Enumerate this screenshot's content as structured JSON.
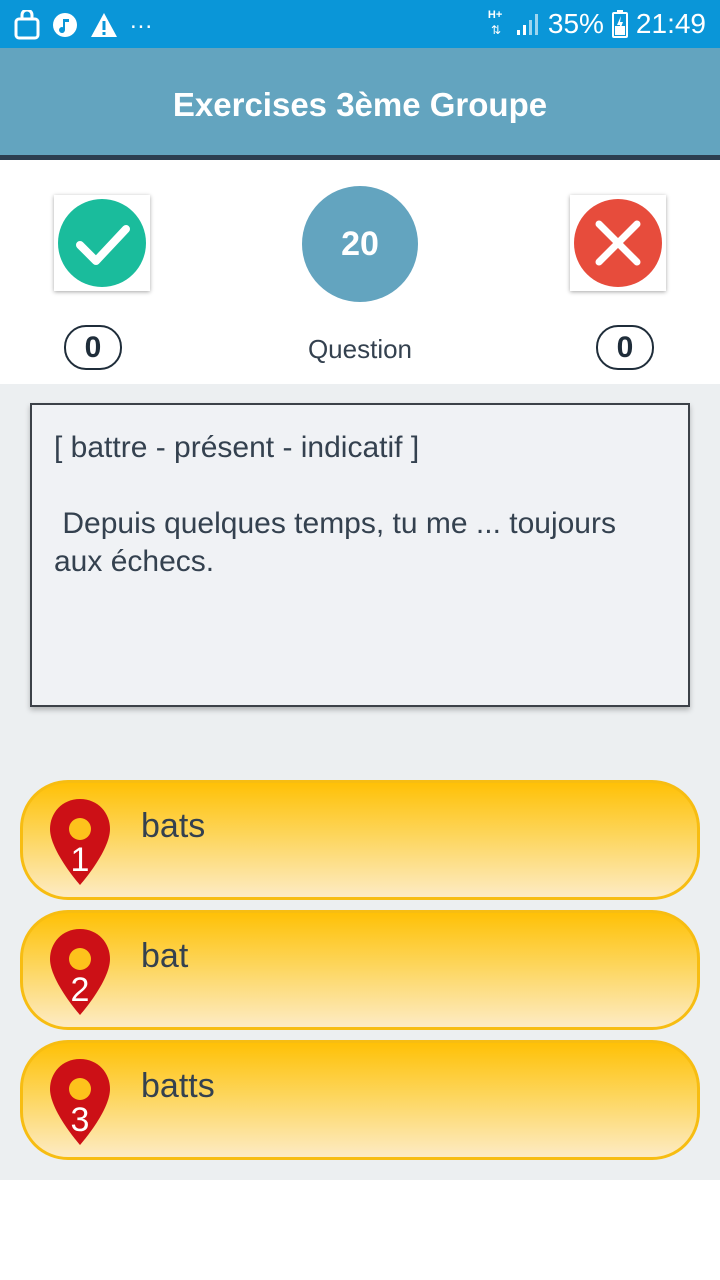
{
  "status_bar": {
    "battery": "35%",
    "time": "21:49",
    "network": "H+",
    "overflow": "...",
    "icons": [
      "bag-icon",
      "music-icon",
      "warning-icon",
      "data-arrows-icon",
      "signal-icon",
      "battery-charging-icon"
    ]
  },
  "app_bar": {
    "title": "Exercises 3ème Groupe"
  },
  "score": {
    "correct_count": "0",
    "wrong_count": "0",
    "question_number": "20",
    "question_label": "Question"
  },
  "question": {
    "prompt": "[ battre - présent - indicatif ]",
    "sentence": "Depuis quelques temps, tu me ... toujours aux échecs."
  },
  "answers": [
    {
      "number": "1",
      "label": "bats"
    },
    {
      "number": "2",
      "label": "bat"
    },
    {
      "number": "3",
      "label": "batts"
    }
  ],
  "colors": {
    "status_bar": "#0a96d8",
    "app_bar": "#63a4bf",
    "correct": "#1abc9c",
    "wrong": "#e74c3c",
    "answer_gold": "#ffc107",
    "pin_red": "#cc1016"
  }
}
